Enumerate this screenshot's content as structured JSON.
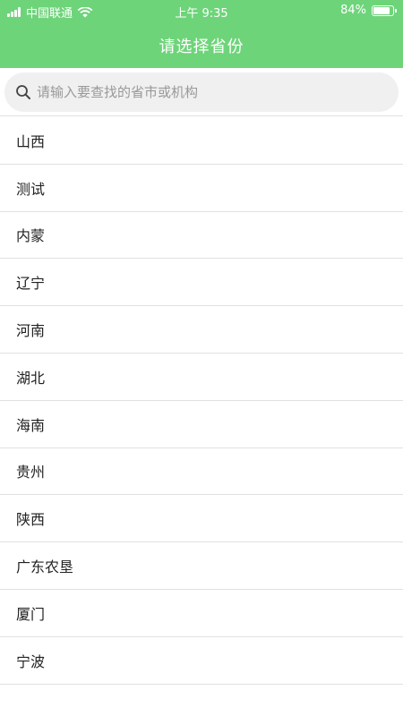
{
  "status_bar": {
    "carrier": "中国联通",
    "time": "上午 9:35",
    "battery": "84%"
  },
  "header": {
    "title": "请选择省份"
  },
  "search": {
    "placeholder": "请输入要查找的省市或机构"
  },
  "provinces": [
    {
      "label": "山西"
    },
    {
      "label": "测试"
    },
    {
      "label": "内蒙"
    },
    {
      "label": "辽宁"
    },
    {
      "label": "河南"
    },
    {
      "label": "湖北"
    },
    {
      "label": "海南"
    },
    {
      "label": "贵州"
    },
    {
      "label": "陕西"
    },
    {
      "label": "广东农垦"
    },
    {
      "label": "厦门"
    },
    {
      "label": "宁波"
    }
  ],
  "colors": {
    "header": "#6ed47a",
    "search_bg": "#f0f0f0",
    "divider": "#e1e1e1"
  }
}
